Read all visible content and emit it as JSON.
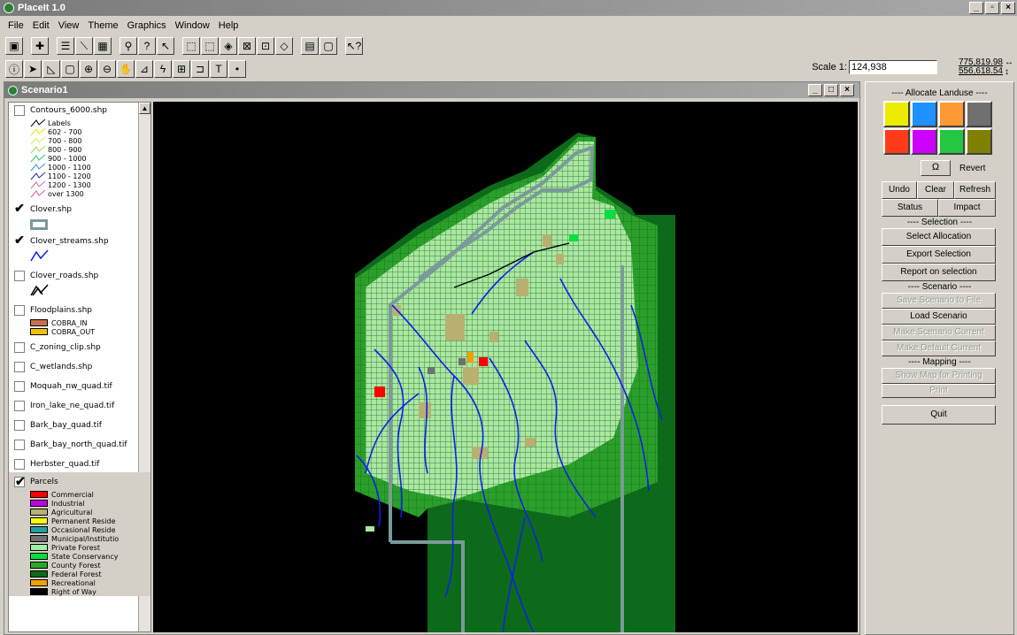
{
  "app": {
    "title": "PlaceIt 1.0"
  },
  "menu": [
    "File",
    "Edit",
    "View",
    "Theme",
    "Graphics",
    "Window",
    "Help"
  ],
  "toolbar_icons": [
    "save-icon",
    "add-theme-icon",
    "properties-icon",
    "edit-legend-icon",
    "table-icon",
    "find-icon",
    "query-icon",
    "hotlink-icon",
    "zoom-full-icon",
    "zoom-active-icon",
    "zoom-selected-icon",
    "zoom-in-fixed-icon",
    "zoom-out-fixed-icon",
    "zoom-previous-icon",
    "select-by-theme-icon",
    "clear-selection-icon",
    "help-icon"
  ],
  "tools_icons": [
    "identify-icon",
    "pointer-icon",
    "vertex-edit-icon",
    "select-feature-icon",
    "zoom-in-icon",
    "zoom-out-icon",
    "pan-icon",
    "measure-icon",
    "hotlink-tool-icon",
    "area-of-interest-icon",
    "label-icon",
    "text-icon",
    "draw-point-icon"
  ],
  "scale": {
    "label": "Scale 1:",
    "value": "124,938"
  },
  "coords": {
    "x": "775,819.98",
    "y": "556,618.54"
  },
  "scenario": {
    "title": "Scenario1"
  },
  "legend": {
    "contours": {
      "name": "Contours_6000.shp",
      "items": [
        "Labels",
        "602 - 700",
        "700 - 800",
        "800 - 900",
        "900 - 1000",
        "1000 - 1100",
        "1100 - 1200",
        "1200 - 1300",
        "over 1300"
      ],
      "colors": [
        "#000000",
        "#e8e800",
        "#d8f060",
        "#9ad84a",
        "#3cc06a",
        "#3a8cd8",
        "#1c2ca0",
        "#c870a0",
        "#e060a0"
      ]
    },
    "layers": [
      {
        "name": "Clover.shp",
        "checked": "✔"
      },
      {
        "name": "Clover_streams.shp",
        "checked": "✔"
      },
      {
        "name": "Clover_roads.shp",
        "checked": ""
      },
      {
        "name": "Floodplains.shp",
        "checked": "",
        "items": [
          "COBRA_IN",
          "COBRA_OUT"
        ],
        "colors": [
          "#c87050",
          "#f0c000"
        ]
      },
      {
        "name": "C_zoning_clip.shp",
        "checked": ""
      },
      {
        "name": "C_wetlands.shp",
        "checked": ""
      },
      {
        "name": "Moquah_nw_quad.tif",
        "checked": ""
      },
      {
        "name": "Iron_lake_ne_quad.tif",
        "checked": ""
      },
      {
        "name": "Bark_bay_quad.tif",
        "checked": ""
      },
      {
        "name": "Bark_bay_north_quad.tif",
        "checked": ""
      },
      {
        "name": "Herbster_quad.tif",
        "checked": ""
      }
    ],
    "parcels": {
      "name": "Parcels",
      "checked": "✔",
      "items": [
        "Commercial",
        "Industrial",
        "Agricultural",
        "Permanent Reside",
        "Occasional Reside",
        "Municipal/Institutio",
        "Private Forest",
        "State Conservancy",
        "County Forest",
        "Federal Forest",
        "Recreational",
        "Right of Way"
      ],
      "colors": [
        "#ff0000",
        "#c000e0",
        "#b8b070",
        "#ffff00",
        "#20a0a0",
        "#707070",
        "#a0f0a0",
        "#00e040",
        "#28a828",
        "#0c6a1a",
        "#f0a000",
        "#000000"
      ]
    }
  },
  "panel": {
    "allocate_title": "---- Allocate Landuse ----",
    "swatch_colors": [
      "#ecec00",
      "#1e90ff",
      "#ff9933",
      "#707070",
      "#ff3b1a",
      "#cc00ff",
      "#22c840",
      "#808000"
    ],
    "revert_icon": "Ω",
    "revert_label": "Revert",
    "undo": "Undo",
    "clear": "Clear",
    "refresh": "Refresh",
    "status": "Status",
    "impact": "Impact",
    "selection_title": "---- Selection ----",
    "select_allocation": "Select Allocation",
    "export_selection": "Export Selection",
    "report_selection": "Report on selection",
    "scenario_title": "---- Scenario ----",
    "save_scenario": "Save Scenario to File",
    "load_scenario": "Load Scenario",
    "make_scenario_current": "Make Scenario Current",
    "make_default_current": "Make Default Current",
    "mapping_title": "---- Mapping ----",
    "show_map": "Show Map for Printing",
    "print": "Print",
    "quit": "Quit"
  }
}
